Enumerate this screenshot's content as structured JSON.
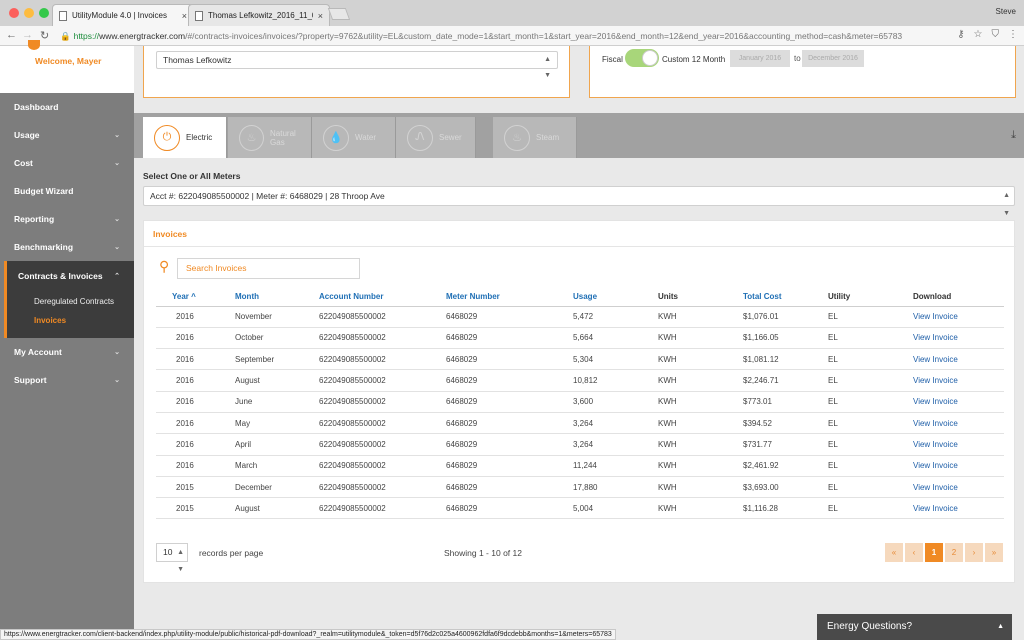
{
  "browser": {
    "profile": "Steve",
    "tabs": [
      {
        "label": "UtilityModule 4.0 | Invoices",
        "close": "×"
      },
      {
        "label": "Thomas Lefkowitz_2016_11_0",
        "close": "×"
      }
    ],
    "url_secure": "https://",
    "url_domain": "www.energtracker.com",
    "url_rest": "/#/contracts-invoices/invoices/?property=9762&utility=EL&custom_date_mode=1&start_month=1&start_year=2016&end_month=12&end_year=2016&accounting_method=cash&meter=65783",
    "status_url": "https://www.energtracker.com/client-backend/index.php/utility-module/public/historical-pdf-download?_realm=utilitymodule&_token=d5f76d2c025a4600962fdfa6f9dcdebb&months=1&meters=65783"
  },
  "sidebar": {
    "welcome": "Welcome, Mayer",
    "items": [
      {
        "label": "Dashboard",
        "chev": ""
      },
      {
        "label": "Usage",
        "chev": "⌄"
      },
      {
        "label": "Cost",
        "chev": "⌄"
      },
      {
        "label": "Budget Wizard",
        "chev": ""
      },
      {
        "label": "Reporting",
        "chev": "⌄"
      },
      {
        "label": "Benchmarking",
        "chev": "⌄"
      }
    ],
    "contracts": {
      "label": "Contracts & Invoices",
      "chev": "⌃",
      "subitems": [
        "Deregulated Contracts",
        "Invoices"
      ]
    },
    "bottom_items": [
      {
        "label": "My Account",
        "chev": "⌄"
      },
      {
        "label": "Support",
        "chev": "⌄"
      }
    ]
  },
  "filters": {
    "property": "Thomas Lefkowitz",
    "fiscal_label": "Fiscal",
    "custom_label": "Custom 12 Month",
    "date_from": "January 2016",
    "to_label": "to",
    "date_to": "December 2016"
  },
  "utility_tabs": [
    {
      "label": "Electric",
      "icon": "plug-icon"
    },
    {
      "label": "Natural Gas",
      "icon": "flame-icon"
    },
    {
      "label": "Water",
      "icon": "drop-icon"
    },
    {
      "label": "Sewer",
      "icon": "pipe-icon"
    },
    {
      "label": "Steam",
      "icon": "steam-icon"
    }
  ],
  "meters": {
    "label": "Select One or All Meters",
    "selected": "Acct #: 622049085500002 | Meter #: 6468029 | 28 Throop Ave"
  },
  "invoices": {
    "title": "Invoices",
    "search_placeholder": "Search Invoices",
    "columns": [
      "Year ^",
      "Month",
      "Account Number",
      "Meter Number",
      "Usage",
      "Units",
      "Total Cost",
      "Utility",
      "Download"
    ],
    "rows": [
      [
        "2016",
        "November",
        "622049085500002",
        "6468029",
        "5,472",
        "KWH",
        "$1,076.01",
        "EL",
        "View Invoice"
      ],
      [
        "2016",
        "October",
        "622049085500002",
        "6468029",
        "5,664",
        "KWH",
        "$1,166.05",
        "EL",
        "View Invoice"
      ],
      [
        "2016",
        "September",
        "622049085500002",
        "6468029",
        "5,304",
        "KWH",
        "$1,081.12",
        "EL",
        "View Invoice"
      ],
      [
        "2016",
        "August",
        "622049085500002",
        "6468029",
        "10,812",
        "KWH",
        "$2,246.71",
        "EL",
        "View Invoice"
      ],
      [
        "2016",
        "June",
        "622049085500002",
        "6468029",
        "3,600",
        "KWH",
        "$773.01",
        "EL",
        "View Invoice"
      ],
      [
        "2016",
        "May",
        "622049085500002",
        "6468029",
        "3,264",
        "KWH",
        "$394.52",
        "EL",
        "View Invoice"
      ],
      [
        "2016",
        "April",
        "622049085500002",
        "6468029",
        "3,264",
        "KWH",
        "$731.77",
        "EL",
        "View Invoice"
      ],
      [
        "2016",
        "March",
        "622049085500002",
        "6468029",
        "11,244",
        "KWH",
        "$2,461.92",
        "EL",
        "View Invoice"
      ],
      [
        "2015",
        "December",
        "622049085500002",
        "6468029",
        "17,880",
        "KWH",
        "$3,693.00",
        "EL",
        "View Invoice"
      ],
      [
        "2015",
        "August",
        "622049085500002",
        "6468029",
        "5,004",
        "KWH",
        "$1,116.28",
        "EL",
        "View Invoice"
      ]
    ],
    "per_page": "10",
    "per_page_label": "records per page",
    "showing": "Showing 1 - 10 of 12",
    "pager": [
      "«",
      "‹",
      "1",
      "2",
      "›",
      "»"
    ],
    "active_page": "1"
  },
  "energy_questions": "Energy Questions?",
  "colors": {
    "accent": "#f08a24",
    "link": "#1f5fa8",
    "sidebar": "#7d7d7d"
  }
}
